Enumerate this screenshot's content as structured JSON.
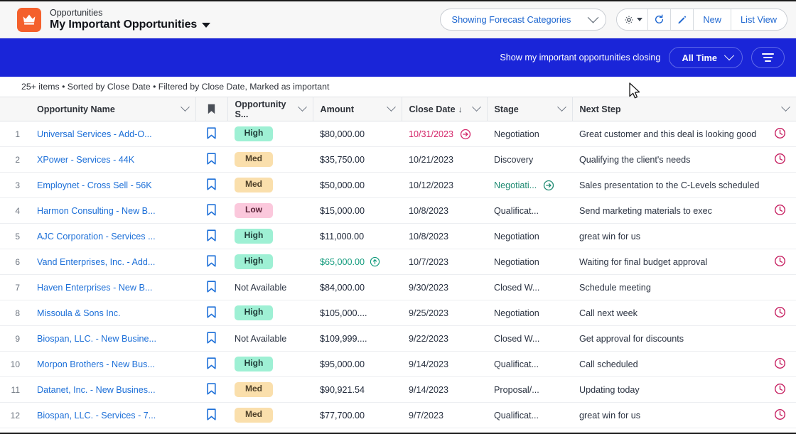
{
  "header": {
    "object_label": "Opportunities",
    "list_title": "My Important Opportunities",
    "logo_icon": "crown-icon",
    "title_dropdown_icon": "caret-down-icon",
    "forecast_select": "Showing Forecast Categories",
    "forecast_chevron_icon": "chevron-down-icon",
    "buttons": {
      "settings_icon": "gear-icon",
      "settings_caret_icon": "caret-down-icon",
      "refresh_icon": "refresh-icon",
      "edit_icon": "pencil-icon",
      "new_label": "New",
      "list_view_label": "List View"
    }
  },
  "banner": {
    "prompt": "Show my important opportunities closing",
    "time_filter": "All Time",
    "time_filter_chevron_icon": "chevron-down-icon",
    "filter_icon": "filter-lines-icon",
    "background_color": "#1a25d8"
  },
  "info_bar": {
    "text": "25+ items • Sorted by Close Date • Filtered by Close Date, Marked as important"
  },
  "table": {
    "columns": [
      {
        "key": "idx",
        "label": ""
      },
      {
        "key": "name",
        "label": "Opportunity Name"
      },
      {
        "key": "bm",
        "label": "",
        "icon": "bookmark-icon"
      },
      {
        "key": "score",
        "label": "Opportunity S..."
      },
      {
        "key": "amt",
        "label": "Amount"
      },
      {
        "key": "date",
        "label": "Close Date",
        "sorted": "desc",
        "sort_icon": "arrow-down-icon"
      },
      {
        "key": "stage",
        "label": "Stage"
      },
      {
        "key": "next",
        "label": "Next Step"
      }
    ],
    "rows": [
      {
        "idx": "1",
        "name": "Universal Services - Add-O...",
        "score": "High",
        "score_type": "high",
        "amount": "$80,000.00",
        "amount_trend": false,
        "date": "10/31/2023",
        "date_overdue": true,
        "date_icon": true,
        "stage": "Negotiation",
        "stage_green": false,
        "stage_icon": false,
        "next": "Great customer and this deal is looking good",
        "clock": true
      },
      {
        "idx": "2",
        "name": "XPower - Services - 44K",
        "score": "Med",
        "score_type": "med",
        "amount": "$35,750.00",
        "amount_trend": false,
        "date": "10/21/2023",
        "date_overdue": false,
        "date_icon": false,
        "stage": "Discovery",
        "stage_green": false,
        "stage_icon": false,
        "next": "Qualifying the client's needs",
        "clock": true
      },
      {
        "idx": "3",
        "name": "Employnet - Cross Sell - 56K",
        "score": "Med",
        "score_type": "med",
        "amount": "$50,000.00",
        "amount_trend": false,
        "date": "10/12/2023",
        "date_overdue": false,
        "date_icon": false,
        "stage": "Negotiati...",
        "stage_green": true,
        "stage_icon": true,
        "next": "Sales presentation to the C-Levels scheduled",
        "clock": false
      },
      {
        "idx": "4",
        "name": "Harmon Consulting - New B...",
        "score": "Low",
        "score_type": "low",
        "amount": "$15,000.00",
        "amount_trend": false,
        "date": "10/8/2023",
        "date_overdue": false,
        "date_icon": false,
        "stage": "Qualificat...",
        "stage_green": false,
        "stage_icon": false,
        "next": "Send marketing materials to exec",
        "clock": true
      },
      {
        "idx": "5",
        "name": "AJC Corporation - Services ...",
        "score": "High",
        "score_type": "high",
        "amount": "$11,000.00",
        "amount_trend": false,
        "date": "10/8/2023",
        "date_overdue": false,
        "date_icon": false,
        "stage": "Negotiation",
        "stage_green": false,
        "stage_icon": false,
        "next": "great win for us",
        "clock": false
      },
      {
        "idx": "6",
        "name": "Vand Enterprises, Inc. - Add...",
        "score": "High",
        "score_type": "high",
        "amount": "$65,000.00",
        "amount_trend": true,
        "date": "10/7/2023",
        "date_overdue": false,
        "date_icon": false,
        "stage": "Negotiation",
        "stage_green": false,
        "stage_icon": false,
        "next": "Waiting for final budget approval",
        "clock": true
      },
      {
        "idx": "7",
        "name": "Haven Enterprises - New B...",
        "score": "Not Available",
        "score_type": "na",
        "amount": "$84,000.00",
        "amount_trend": false,
        "date": "9/30/2023",
        "date_overdue": false,
        "date_icon": false,
        "stage": "Closed W...",
        "stage_green": false,
        "stage_icon": false,
        "next": "Schedule meeting",
        "clock": false
      },
      {
        "idx": "8",
        "name": "Missoula & Sons Inc.",
        "score": "High",
        "score_type": "high",
        "amount": "$105,000....",
        "amount_trend": false,
        "date": "9/25/2023",
        "date_overdue": false,
        "date_icon": false,
        "stage": "Negotiation",
        "stage_green": false,
        "stage_icon": false,
        "next": "Call next week",
        "clock": true
      },
      {
        "idx": "9",
        "name": "Biospan, LLC. - New Busine...",
        "score": "Not Available",
        "score_type": "na",
        "amount": "$109,999....",
        "amount_trend": false,
        "date": "9/22/2023",
        "date_overdue": false,
        "date_icon": false,
        "stage": "Closed W...",
        "stage_green": false,
        "stage_icon": false,
        "next": "Get approval for discounts",
        "clock": false
      },
      {
        "idx": "10",
        "name": "Morpon Brothers - New Bus...",
        "score": "High",
        "score_type": "high",
        "amount": "$95,000.00",
        "amount_trend": false,
        "date": "9/14/2023",
        "date_overdue": false,
        "date_icon": false,
        "stage": "Qualificat...",
        "stage_green": false,
        "stage_icon": false,
        "next": "Call scheduled",
        "clock": true
      },
      {
        "idx": "11",
        "name": "Datanet, Inc. - New Busines...",
        "score": "Med",
        "score_type": "med",
        "amount": "$90,921.54",
        "amount_trend": false,
        "date": "9/14/2023",
        "date_overdue": false,
        "date_icon": false,
        "stage": "Proposal/...",
        "stage_green": false,
        "stage_icon": false,
        "next": "Updating today",
        "clock": true
      },
      {
        "idx": "12",
        "name": "Biospan, LLC. - Services - 7...",
        "score": "Med",
        "score_type": "med",
        "amount": "$77,700.00",
        "amount_trend": false,
        "date": "9/7/2023",
        "date_overdue": false,
        "date_icon": false,
        "stage": "Qualificat...",
        "stage_green": false,
        "stage_icon": false,
        "next": "great win for us",
        "clock": true
      }
    ]
  },
  "colors": {
    "brand_orange": "#f4602c",
    "banner_blue": "#1a25d8",
    "link_blue": "#1c6fd8",
    "overdue_red": "#d4286b",
    "clock_red": "#c72363",
    "trend_green": "#139b7d",
    "badge_high": "#9ef0d4",
    "badge_med": "#fadfac",
    "badge_low": "#fbc8dc"
  }
}
